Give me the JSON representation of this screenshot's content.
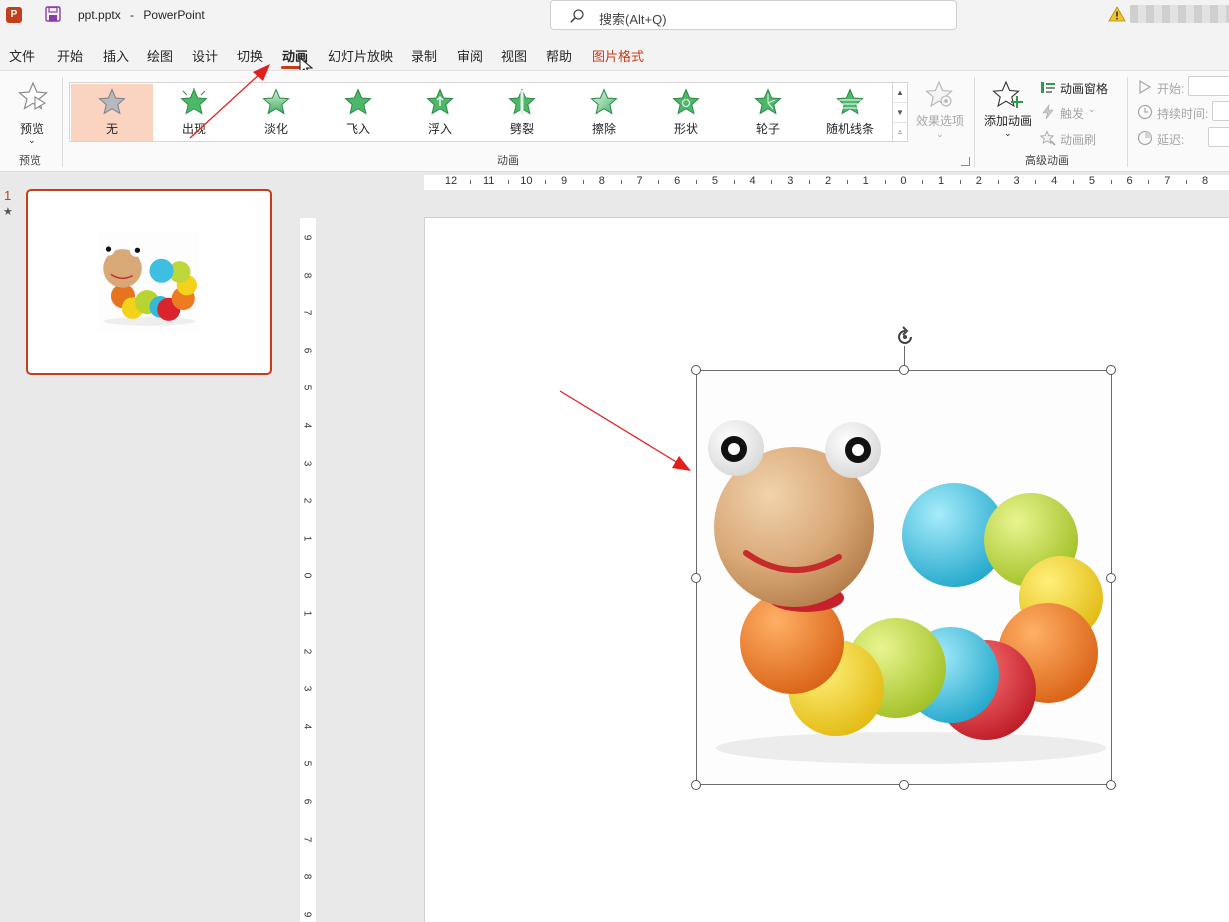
{
  "titlebar": {
    "app_badge": "P",
    "filename": "ppt.pptx",
    "separator": "-",
    "app_name": "PowerPoint",
    "search_placeholder": "搜索(Alt+Q)"
  },
  "menu": {
    "tabs": [
      {
        "label": "文件"
      },
      {
        "label": "开始"
      },
      {
        "label": "插入"
      },
      {
        "label": "绘图"
      },
      {
        "label": "设计"
      },
      {
        "label": "切换"
      },
      {
        "label": "动画"
      },
      {
        "label": "幻灯片放映"
      },
      {
        "label": "录制"
      },
      {
        "label": "审阅"
      },
      {
        "label": "视图"
      },
      {
        "label": "帮助"
      },
      {
        "label": "图片格式"
      }
    ],
    "active_tab": "动画"
  },
  "ribbon": {
    "preview": {
      "button_label": "预览",
      "group_label": "预览"
    },
    "animation_gallery": {
      "items": [
        {
          "label": "无",
          "selected": true,
          "icon": "star-gray-icon"
        },
        {
          "label": "出现",
          "icon": "star-burst-green-icon"
        },
        {
          "label": "淡化",
          "icon": "star-fade-green-icon"
        },
        {
          "label": "飞入",
          "icon": "star-fly-green-icon"
        },
        {
          "label": "浮入",
          "icon": "star-float-green-icon"
        },
        {
          "label": "劈裂",
          "icon": "star-split-green-icon"
        },
        {
          "label": "擦除",
          "icon": "star-wipe-green-icon"
        },
        {
          "label": "形状",
          "icon": "star-shape-green-icon"
        },
        {
          "label": "轮子",
          "icon": "star-wheel-green-icon"
        },
        {
          "label": "随机线条",
          "icon": "star-lines-green-icon"
        }
      ],
      "effect_options_label": "效果选项",
      "group_label": "动画"
    },
    "advanced": {
      "add_animation_label": "添加动画",
      "animation_pane_label": "动画窗格",
      "trigger_label": "触发",
      "animation_painter_label": "动画刷",
      "group_label": "高级动画"
    },
    "timing": {
      "start_label": "开始:",
      "duration_label": "持续时间:",
      "delay_label": "延迟:"
    }
  },
  "slides_pane": {
    "slide_number": "1",
    "animation_marker": "★"
  },
  "rulers": {
    "top_ticks": [
      "12",
      "11",
      "10",
      "9",
      "8",
      "7",
      "6",
      "5",
      "4",
      "3",
      "2",
      "1",
      "0",
      "1",
      "2",
      "3",
      "4",
      "5",
      "6",
      "7",
      "8"
    ],
    "left_ticks": [
      "9",
      "8",
      "7",
      "6",
      "5",
      "4",
      "3",
      "2",
      "1",
      "0",
      "1",
      "2",
      "3",
      "4",
      "5",
      "6",
      "7",
      "8",
      "9"
    ]
  },
  "slide": {
    "image_alt": "彩色木制毛毛虫玩具",
    "colors": {
      "accent": "#c43e1c",
      "selection_frame": "#6b6b6b",
      "annotation_arrow": "#e02020"
    }
  }
}
